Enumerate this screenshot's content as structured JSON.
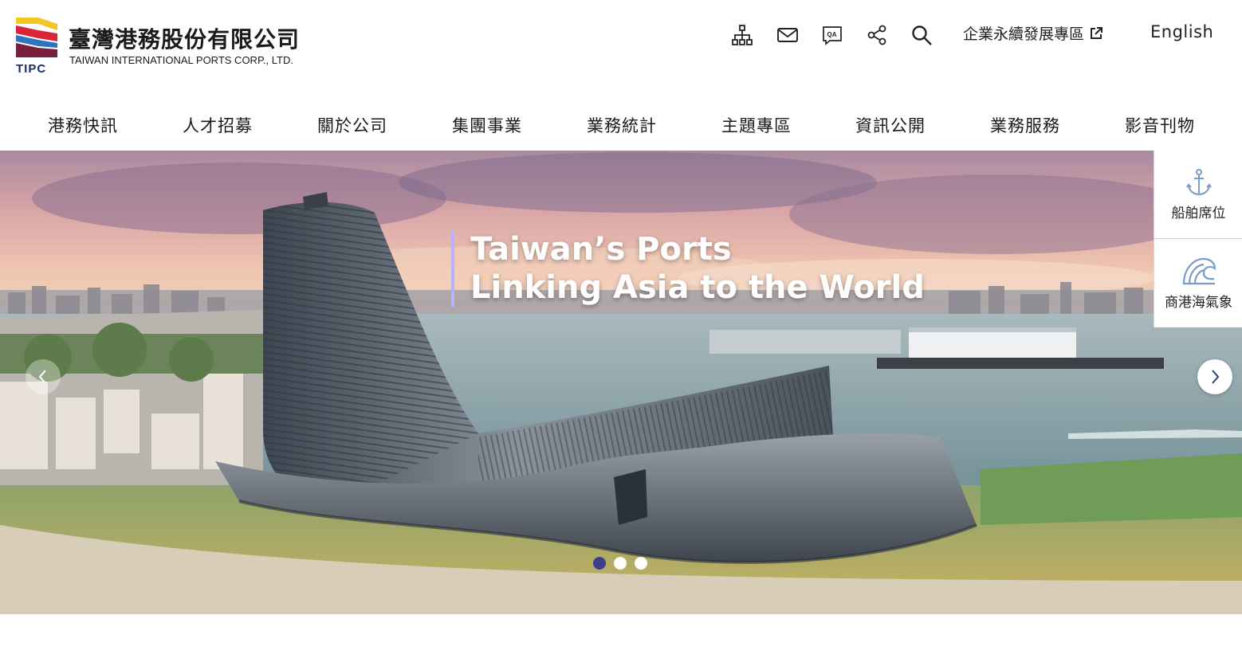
{
  "header": {
    "logo_zh": "臺灣港務股份有限公司",
    "logo_en": "TAIWAN INTERNATIONAL PORTS CORP., LTD.",
    "logo_abbr": "TIPC",
    "tools": [
      {
        "icon": "sitemap-icon"
      },
      {
        "icon": "mail-icon"
      },
      {
        "icon": "qa-icon"
      },
      {
        "icon": "share-icon"
      },
      {
        "icon": "search-icon"
      }
    ],
    "csr_link": "企業永續發展專區",
    "lang_link": "English"
  },
  "nav": {
    "items": [
      "港務快訊",
      "人才招募",
      "關於公司",
      "集團事業",
      "業務統計",
      "主題專區",
      "資訊公開",
      "業務服務",
      "影音刊物"
    ]
  },
  "banner": {
    "slogan_line1": "Taiwan’s Ports",
    "slogan_line2": "Linking Asia to the World",
    "slides_total": 3,
    "active_slide": 1
  },
  "side": {
    "items": [
      {
        "label": "船舶席位",
        "icon": "anchor-icon"
      },
      {
        "label": "商港海氣象",
        "icon": "wave-icon"
      }
    ]
  },
  "colors": {
    "brand_blue": "#1b2c6b",
    "brand_red": "#d9253a",
    "brand_yellow": "#f3c623",
    "side_icon": "#7b9bc8",
    "dot_active": "#3c3f8f",
    "slogan_bar": "#b9b2ff"
  }
}
